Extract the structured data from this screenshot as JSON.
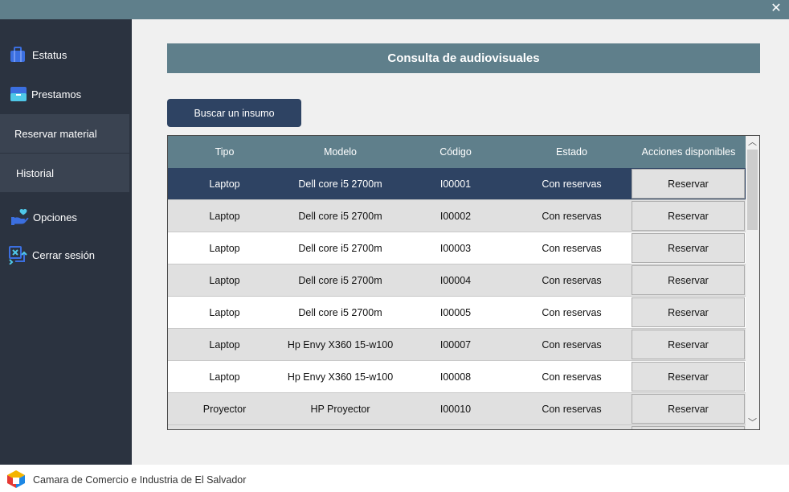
{
  "window": {
    "close_glyph": "✕"
  },
  "sidebar": {
    "items": [
      {
        "label": "Estatus",
        "icon": "briefcase-icon"
      },
      {
        "label": "Prestamos",
        "icon": "folder-icon"
      },
      {
        "label": "Reservar material"
      },
      {
        "label": "Historial"
      },
      {
        "label": "Opciones",
        "icon": "hand-heart-icon"
      },
      {
        "label": "Cerrar sesión",
        "icon": "logout-icon"
      }
    ]
  },
  "main": {
    "title": "Consulta de audiovisuales",
    "search_button": "Buscar un insumo",
    "table": {
      "headers": [
        "Tipo",
        "Modelo",
        "Código",
        "Estado",
        "Acciones disponibles"
      ],
      "action_label": "Reservar",
      "rows": [
        {
          "tipo": "Laptop",
          "modelo": "Dell core i5 2700m",
          "codigo": "I00001",
          "estado": "Con reservas"
        },
        {
          "tipo": "Laptop",
          "modelo": "Dell core i5 2700m",
          "codigo": "I00002",
          "estado": "Con reservas"
        },
        {
          "tipo": "Laptop",
          "modelo": "Dell core i5 2700m",
          "codigo": "I00003",
          "estado": "Con reservas"
        },
        {
          "tipo": "Laptop",
          "modelo": "Dell core i5 2700m",
          "codigo": "I00004",
          "estado": "Con reservas"
        },
        {
          "tipo": "Laptop",
          "modelo": "Dell core i5 2700m",
          "codigo": "I00005",
          "estado": "Con reservas"
        },
        {
          "tipo": "Laptop",
          "modelo": "Hp Envy X360 15-w100",
          "codigo": "I00007",
          "estado": "Con reservas"
        },
        {
          "tipo": "Laptop",
          "modelo": "Hp Envy X360 15-w100",
          "codigo": "I00008",
          "estado": "Con reservas"
        },
        {
          "tipo": "Proyector",
          "modelo": "HP Proyector",
          "codigo": "I00010",
          "estado": "Con reservas"
        }
      ]
    }
  },
  "footer": {
    "text": "Camara de Comercio e Industria de El Salvador"
  },
  "colors": {
    "accent": "#5f7f8b",
    "navy": "#2e4363",
    "sidebar": "#2b3340"
  }
}
